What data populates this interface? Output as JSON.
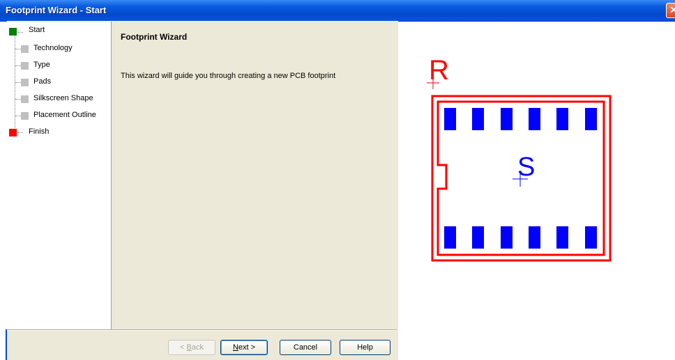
{
  "window": {
    "title": "Footprint Wizard - Start",
    "close_glyph": "✕"
  },
  "steps": [
    {
      "label": "Start",
      "status": "current",
      "color": "#008000"
    },
    {
      "label": "Technology",
      "status": "pending",
      "color": "#c0c0c0"
    },
    {
      "label": "Type",
      "status": "pending",
      "color": "#c0c0c0"
    },
    {
      "label": "Pads",
      "status": "pending",
      "color": "#c0c0c0"
    },
    {
      "label": "Silkscreen Shape",
      "status": "pending",
      "color": "#c0c0c0"
    },
    {
      "label": "Placement Outline",
      "status": "pending",
      "color": "#c0c0c0"
    },
    {
      "label": "Finish",
      "status": "end",
      "color": "#ff0000"
    }
  ],
  "content": {
    "title": "Footprint Wizard",
    "intro": "This wizard will guide you through creating a new PCB footprint"
  },
  "buttons": {
    "back": {
      "pre": "< ",
      "mnemonic": "B",
      "rest": "ack"
    },
    "next": {
      "mnemonic": "N",
      "rest": "ext >"
    },
    "cancel": "Cancel",
    "help": "Help"
  },
  "preview": {
    "reference_label": "R",
    "part_label": "S",
    "outline_color": "#ff0000",
    "pad_color": "#0000ff"
  }
}
